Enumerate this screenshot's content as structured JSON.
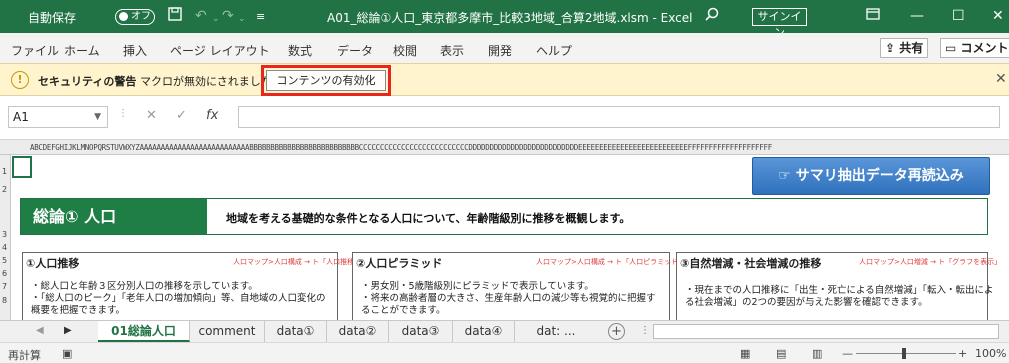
{
  "titlebar": {
    "autosave_label": "自動保存",
    "autosave_state": "オフ",
    "filename": "A01_総論①人口_東京都多摩市_比較3地域_合算2地域.xlsm  -  Excel",
    "signin": "サインイン"
  },
  "ribbon": {
    "tabs": [
      "ファイル",
      "ホーム",
      "挿入",
      "ページ レイアウト",
      "数式",
      "データ",
      "校閲",
      "表示",
      "開発",
      "ヘルプ"
    ],
    "share": "共有",
    "comment": "コメント"
  },
  "message_bar": {
    "title": "セキュリティの警告",
    "text": "マクロが無効にされました。",
    "button": "コンテンツの有効化"
  },
  "formula_bar": {
    "namebox": "A1",
    "fx": "fx",
    "value": ""
  },
  "sheet": {
    "column_letters": "ABCDEFGHIJKLMNOPQRSTUVWXYZAAAAAAAAAAAAAAAAAAAAAAAAAABBBBBBBBBBBBBBBBBBBBBBBBBBCCCCCCCCCCCCCCCCCCCCCCCCCCDDDDDDDDDDDDDDDDDDDDDDDDDDEEEEEEEEEEEEEEEEEEEEEEEEEEFFFFFFFFFFFFFFFFFFFF",
    "row_numbers": [
      "1",
      "2",
      "3",
      "4",
      "5",
      "6",
      "7",
      "8"
    ],
    "reload_button": "☞ サマリ抽出データ再読込み",
    "banner_title": "総論①  人口",
    "banner_desc": "地域を考える基礎的な条件となる人口について、年齢階級別に推移を概観します。",
    "boxes": [
      {
        "title": "①人口推移",
        "link": "人口マップ>人口構成 → ト「人口推移」",
        "lines": [
          "・総人口と年齢３区分別人口の推移を示しています。",
          "・「総人口のピーク」「老年人口の増加傾向」等、自地域の人口変化の",
          "  概要を把握できます。"
        ]
      },
      {
        "title": "②人口ピラミッド",
        "link": "人口マップ>人口構成 → ト「人口ピラミッド」",
        "lines": [
          "・男女別・5歳階級別にピラミッドで表示しています。",
          "・将来の高齢者層の大きさ、生産年齢人口の減少等も視覚的に把握す",
          "  ることができます。"
        ]
      },
      {
        "title": "③自然増減・社会増減の推移",
        "link": "人口マップ>人口増減 → ト「グラフを表示」",
        "lines": [
          "・現在までの人口推移に「出生・死亡による自然増減」「転入・転出によ",
          "  る社会増減」の2つの要因が与えた影響を確認できます。"
        ]
      }
    ]
  },
  "sheet_tabs": {
    "tabs": [
      "01総論人口",
      "comment",
      "data①",
      "data②",
      "data③",
      "data④",
      "dat: ..."
    ],
    "active_index": 0
  },
  "statusbar": {
    "mode": "再計算",
    "zoom": "100%"
  },
  "colors": {
    "excel_green": "#217346",
    "warning_bg": "#fff4ce",
    "highlight_red": "#e8261d",
    "reload_blue": "#3b7fcc"
  }
}
